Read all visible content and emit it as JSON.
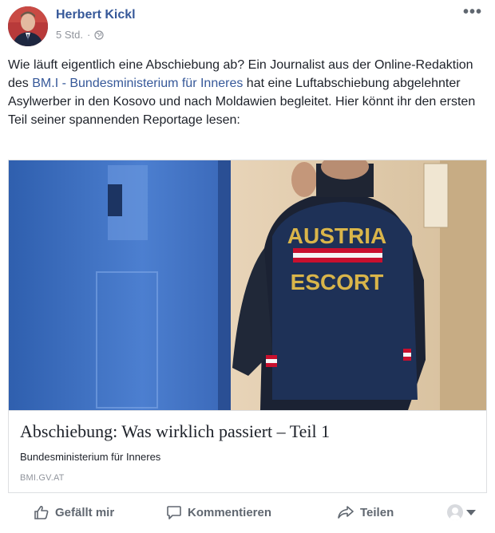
{
  "post": {
    "author": "Herbert Kickl",
    "time": "5 Std.",
    "separator": "·",
    "privacy_icon": "globe-icon",
    "more_label": "•••",
    "text_before_link": "Wie läuft eigentlich eine Abschiebung ab? Ein Journalist aus der Online-Redaktion des ",
    "link_text": "BM.I - Bundesministerium für Inneres",
    "text_after_link": " hat eine Luftabschiebung abgelehnter Asylwerber in den Kosovo und nach Moldawien begleitet. Hier könnt ihr den ersten Teil seiner spannenden Reportage lesen:"
  },
  "card": {
    "image_text_line1": "AUSTRIA",
    "image_text_line2": "ESCORT",
    "title": "Abschiebung: Was wirklich passiert – Teil 1",
    "description": "Bundesministerium für Inneres",
    "domain": "BMI.GV.AT"
  },
  "actions": {
    "like": "Gefällt mir",
    "comment": "Kommentieren",
    "share": "Teilen"
  },
  "colors": {
    "link": "#365899",
    "muted": "#90949c",
    "action": "#606770",
    "vest_text": "#d9b54a"
  }
}
